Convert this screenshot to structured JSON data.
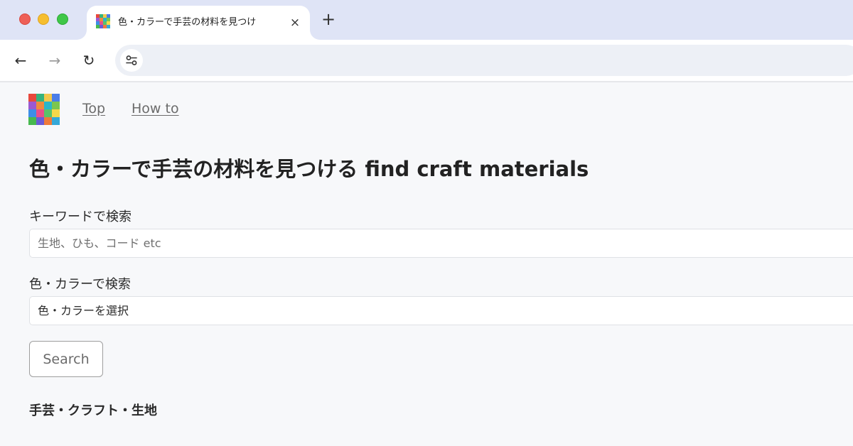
{
  "browser": {
    "tab": {
      "title": "色・カラーで手芸の材料を見つけ",
      "close_icon": "×"
    },
    "new_tab_icon": "+",
    "nav": {
      "back_icon": "←",
      "forward_icon": "→",
      "reload_icon": "↻"
    },
    "address_bar": {
      "value": "",
      "site_info_icon": "tune-icon"
    }
  },
  "favicon_colors": [
    "#e8483c",
    "#36b37e",
    "#f2c84b",
    "#4a7de8",
    "#9b59d0",
    "#f08a3c",
    "#2bb6c9",
    "#7cc64e",
    "#3d8ee8",
    "#e94f8a",
    "#59c36a",
    "#f6d84a",
    "#47b94f",
    "#6a5bd6",
    "#ef7a3a",
    "#35a8d8"
  ],
  "header": {
    "links": {
      "top": "Top",
      "how_to": "How to"
    }
  },
  "main": {
    "title": "色・カラーで手芸の材料を見つける find craft materials",
    "keyword_search": {
      "label": "キーワードで検索",
      "placeholder": "生地、ひも、コード etc",
      "value": ""
    },
    "color_search": {
      "label": "色・カラーで検索",
      "value": "色・カラーを選択"
    },
    "search_button": "Search",
    "section_heading": "手芸・クラフト・生地"
  }
}
